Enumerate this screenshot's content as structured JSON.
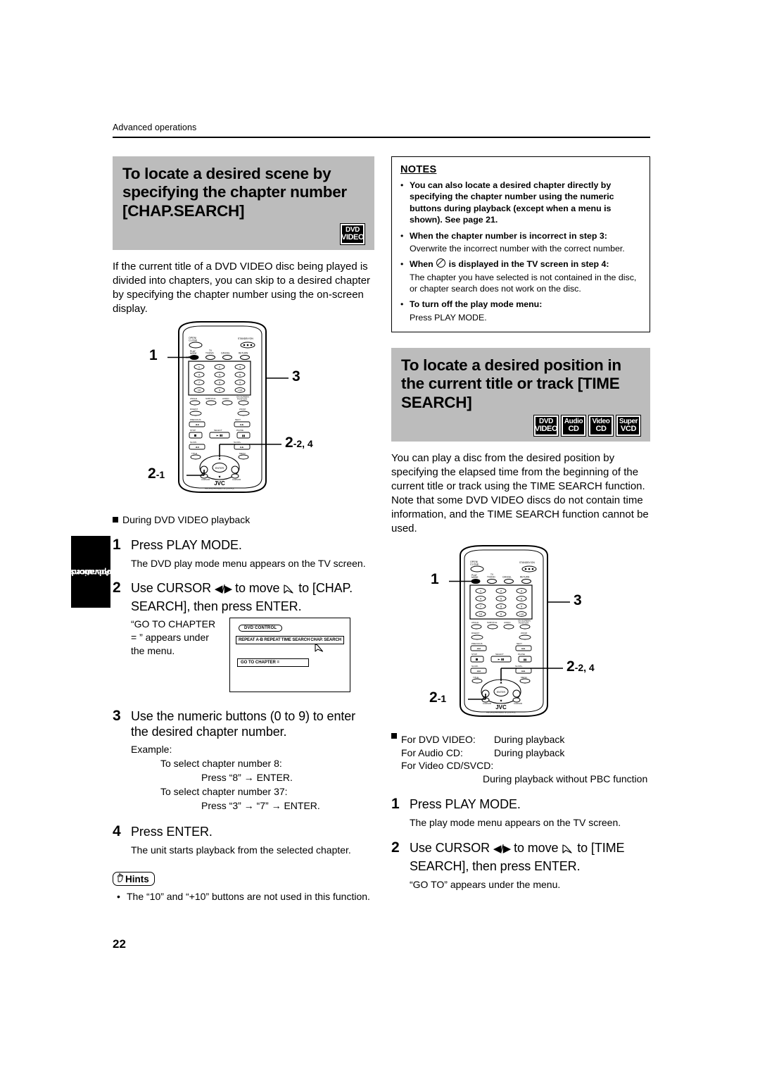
{
  "running_head": "Advanced operations",
  "page_number": "22",
  "side_tab": {
    "line1": "Advanced",
    "line2": "operations"
  },
  "section_chap": {
    "heading": "To locate a desired scene by specifying the chapter number [CHAP.SEARCH]",
    "badges": [
      {
        "line1": "DVD",
        "line2": "VIDEO"
      }
    ],
    "intro": "If the current title of a DVD VIDEO disc being played is divided into chapters, you can skip to a desired chapter by specifying the chapter number using the on-screen display.",
    "lead": "During DVD VIDEO playback",
    "steps": [
      {
        "num": "1",
        "title": "Press PLAY MODE.",
        "body": "The DVD play mode menu appears on the TV screen."
      },
      {
        "num": "2",
        "title_a": "Use CURSOR ",
        "arrows": "◀/▶",
        "title_b": " to move ",
        "title_c": " to [CHAP. SEARCH], then press ENTER.",
        "caption": "“GO TO CHAPTER = ” appears under the menu."
      },
      {
        "num": "3",
        "title": "Use the numeric buttons (0 to 9) to enter the desired chapter number.",
        "example_label": "Example:",
        "example_lines": [
          "To select chapter number 8:",
          "Press “8” → ENTER.",
          "To select chapter number 37:",
          "Press “3” → “7” → ENTER."
        ]
      },
      {
        "num": "4",
        "title": "Press ENTER.",
        "body": "The unit starts playback from the selected chapter."
      }
    ],
    "osd": {
      "title": "DVD CONTROL",
      "menu_items": [
        "REPEAT",
        "A-B REPEAT",
        "TIME SEARCH",
        "CHAP. SEARCH"
      ],
      "goto_label": "GO TO CHAPTER ="
    },
    "hints": {
      "label": "Hints",
      "items": [
        "The “10” and “+10” buttons are not used in this function."
      ]
    }
  },
  "notes": {
    "title": "NOTES",
    "items": [
      {
        "bold": "You can also locate a desired chapter directly by specifying the chapter number using the numeric buttons during playback (except when a menu is shown). See page 21.",
        "sub": ""
      },
      {
        "bold": "When the chapter number is incorrect in step 3:",
        "sub": "Overwrite the incorrect number with the correct number."
      },
      {
        "bold_pre": "When",
        "bold_post": "is displayed in the TV screen in step 4:",
        "glyph": "prohibited-icon",
        "sub": "The chapter you have selected is not contained in the disc, or chapter search does not work on the disc."
      },
      {
        "bold": "To turn off the play mode menu:",
        "sub": "Press PLAY MODE."
      }
    ]
  },
  "section_time": {
    "heading": "To locate a desired position in the current title or track [TIME SEARCH]",
    "badges": [
      {
        "line1": "DVD",
        "line2": "VIDEO"
      },
      {
        "line1": "Audio",
        "line2": "CD"
      },
      {
        "line1": "Video",
        "line2": "CD"
      },
      {
        "line1": "Super",
        "line2": "VCD"
      }
    ],
    "intro": "You can play a disc from the desired position by specifying the elapsed time from the beginning of the current title or track using the TIME SEARCH function. Note that some DVD VIDEO discs do not contain time information, and the TIME SEARCH function cannot be used.",
    "applies": [
      {
        "label": "For DVD VIDEO:",
        "value": "During playback"
      },
      {
        "label": "For Audio CD:",
        "value": "During playback"
      },
      {
        "label": "For Video CD/SVCD:",
        "value": ""
      }
    ],
    "applies_extra": "During playback without PBC function",
    "steps": [
      {
        "num": "1",
        "title": "Press PLAY MODE.",
        "body": "The play mode menu appears on the TV screen."
      },
      {
        "num": "2",
        "title_a": "Use CURSOR ",
        "arrows": "◀/▶",
        "title_b": " to move ",
        "title_c": " to [TIME SEARCH],  then press ENTER.",
        "caption": "“GO TO” appears under the menu."
      }
    ]
  },
  "remote": {
    "brand": "JVC",
    "model_text": "RM-SRVD44A  REMOTE CONTROL",
    "callouts": {
      "one": "1",
      "three": "3",
      "two_two_four_main": "2",
      "two_two_four_sub": "-2, 4",
      "two_one_main": "2",
      "two_one_sub": "-1"
    },
    "labels": {
      "open_close": "OPEN/CLOSE",
      "standby": "STANDBY/ON",
      "play_mode": "PLAY MODE",
      "tv_vcr": "TV/DVD",
      "cancel": "CANCEL",
      "return": "RETURN",
      "angle": "ANGLE",
      "subtitle": "SUBTITLE",
      "audio": "AUDIO",
      "digest": "DIGEST",
      "zoom": "ZOOM",
      "enter": "ENTER"
    },
    "keypad": [
      "1",
      "2",
      "3",
      "4",
      "5",
      "6",
      "7",
      "8",
      "9",
      "10",
      "0",
      "+10"
    ]
  }
}
